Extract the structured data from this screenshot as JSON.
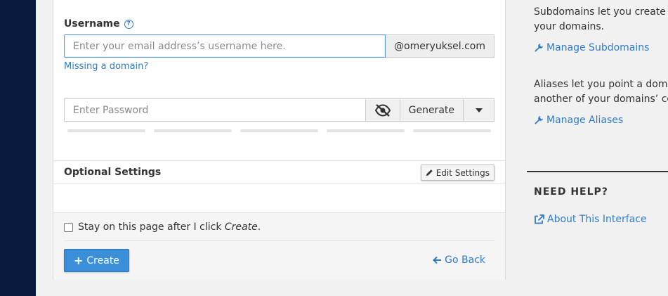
{
  "form": {
    "username_label": "Username",
    "help_icon": "question-circle-icon",
    "username_placeholder": "Enter your email address’s username here.",
    "domain_suffix": "@omeryuksel.com",
    "missing_domain_link": "Missing a domain?",
    "password_placeholder": "Enter Password",
    "eye_icon": "eye-slash-icon",
    "generate_label": "Generate"
  },
  "optional": {
    "title": "Optional Settings",
    "edit_label": "Edit Settings"
  },
  "footer": {
    "stay_text": "Stay on this page after I click",
    "stay_emph": "Create",
    "stay_end": ".",
    "create_label": "Create",
    "goback_label": "Go Back"
  },
  "sidebar": {
    "subdomains_text_1": "Subdomains let you create sub",
    "subdomains_text_2": "your domains.",
    "manage_subdomains": "Manage Subdomains",
    "aliases_text_1": "Aliases let you point a domain",
    "aliases_text_2": "another of your domains’ cont",
    "manage_aliases": "Manage Aliases",
    "need_help": "NEED HELP?",
    "about_interface": "About This Interface"
  },
  "colors": {
    "link": "#2e7bcf",
    "primary": "#3b8fd9",
    "rail": "#0a1a3e"
  }
}
